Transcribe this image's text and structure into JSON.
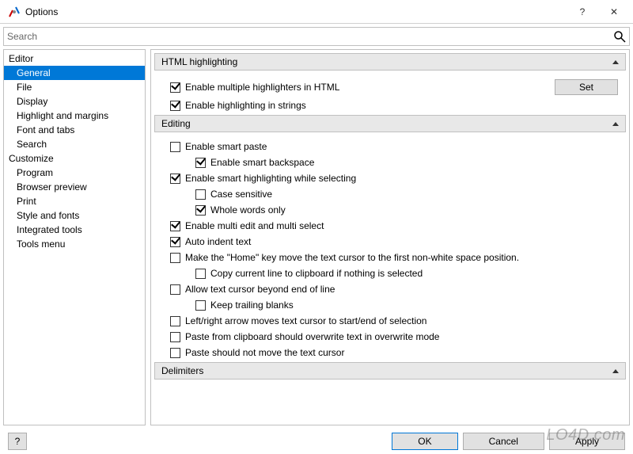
{
  "window": {
    "title": "Options",
    "help_glyph": "?",
    "close_glyph": "✕"
  },
  "search": {
    "placeholder": "Search"
  },
  "sidebar": {
    "groups": [
      {
        "label": "Editor",
        "items": [
          "General",
          "File",
          "Display",
          "Highlight and margins",
          "Font and tabs",
          "Search"
        ]
      },
      {
        "label": "Customize",
        "items": [
          "Program",
          "Browser preview",
          "Print",
          "Style and fonts",
          "Integrated tools",
          "Tools menu"
        ]
      }
    ],
    "selected": "General"
  },
  "sections": {
    "html_highlighting": {
      "title": "HTML highlighting",
      "set_button": "Set",
      "opts": [
        {
          "label": "Enable multiple highlighters in HTML",
          "checked": true
        },
        {
          "label": "Enable highlighting in strings",
          "checked": true
        }
      ]
    },
    "editing": {
      "title": "Editing",
      "opts": [
        {
          "label": "Enable smart paste",
          "checked": false
        },
        {
          "label": "Enable smart backspace",
          "checked": true,
          "indent": true
        },
        {
          "label": "Enable smart highlighting while selecting",
          "checked": true
        },
        {
          "label": "Case sensitive",
          "checked": false,
          "indent": true
        },
        {
          "label": "Whole words only",
          "checked": true,
          "indent": true
        },
        {
          "label": "Enable multi edit and multi select",
          "checked": true
        },
        {
          "label": "Auto indent text",
          "checked": true
        },
        {
          "label": "Make the \"Home\" key move the text cursor to the first non-white space position.",
          "checked": false
        },
        {
          "label": "Copy current line to clipboard if nothing is selected",
          "checked": false,
          "indent": true
        },
        {
          "label": "Allow text cursor beyond end of line",
          "checked": false
        },
        {
          "label": "Keep trailing blanks",
          "checked": false,
          "indent": true
        },
        {
          "label": "Left/right arrow moves text cursor to start/end of selection",
          "checked": false
        },
        {
          "label": "Paste from clipboard should overwrite text in overwrite mode",
          "checked": false
        },
        {
          "label": "Paste should not move the text cursor",
          "checked": false
        }
      ]
    },
    "delimiters": {
      "title": "Delimiters"
    }
  },
  "footer": {
    "help": "?",
    "ok": "OK",
    "cancel": "Cancel",
    "apply": "Apply"
  },
  "watermark": "LO4D.com"
}
